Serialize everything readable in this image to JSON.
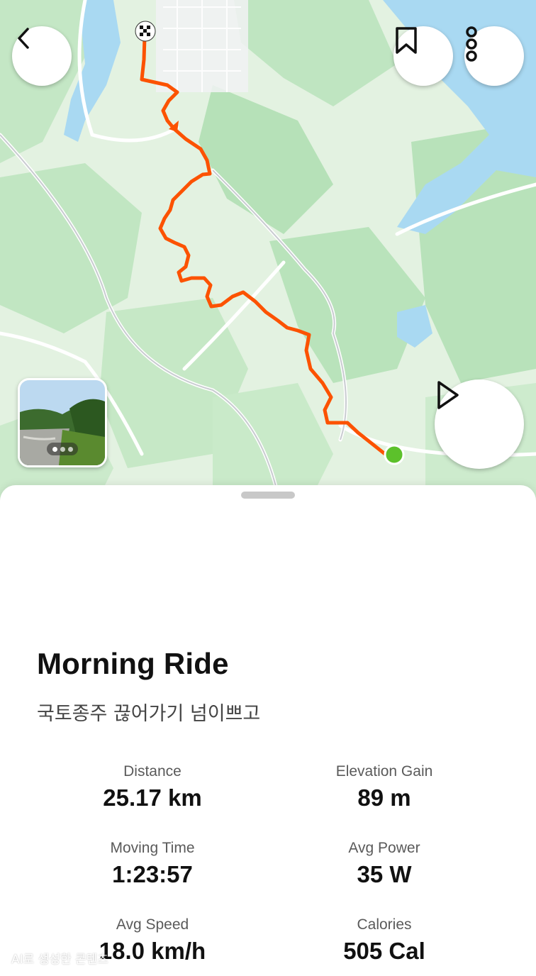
{
  "activity": {
    "title": "Morning Ride",
    "description": "국토종주 끊어가기 넘이쁘고"
  },
  "stats": {
    "distance": {
      "label": "Distance",
      "value": "25.17 km"
    },
    "elevation_gain": {
      "label": "Elevation Gain",
      "value": "89 m"
    },
    "moving_time": {
      "label": "Moving Time",
      "value": "1:23:57"
    },
    "avg_power": {
      "label": "Avg Power",
      "value": "35 W"
    },
    "avg_speed": {
      "label": "Avg Speed",
      "value": "18.0 km/h"
    },
    "calories": {
      "label": "Calories",
      "value": "505 Cal"
    }
  },
  "map": {
    "route_color": "#fc5200",
    "start_marker_color": "#5cc12b",
    "water_color": "#a9d9f2",
    "terrain_color": "#bfe6c0"
  },
  "icons": {
    "back": "chevron-left-icon",
    "bookmark": "bookmark-icon",
    "more": "more-vertical-icon",
    "play": "play-icon"
  },
  "watermark": "AI로 생성한 콘텐츠"
}
